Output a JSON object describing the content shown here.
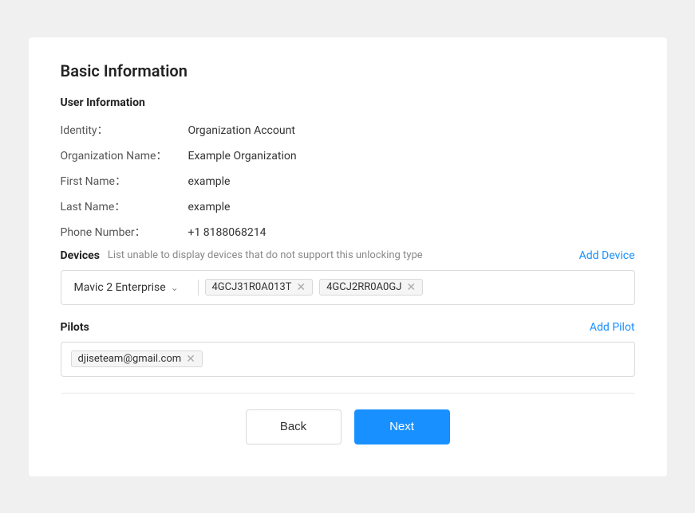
{
  "page": {
    "title": "Basic Information",
    "user_information_label": "User Information",
    "fields": {
      "identity_label": "Identity：",
      "identity_value": "Organization Account",
      "org_name_label": "Organization Name：",
      "org_name_value": "Example Organization",
      "first_name_label": "First Name：",
      "first_name_value": "example",
      "last_name_label": "Last Name：",
      "last_name_value": "example",
      "phone_label": "Phone Number：",
      "phone_value": "+1 8188068214"
    },
    "devices": {
      "label": "Devices",
      "hint": "List unable to display devices that do not support this unlocking type",
      "add_label": "Add Device",
      "select_value": "Mavic 2 Enterprise",
      "tags": [
        {
          "id": "tag-device-1",
          "value": "4GCJ31R0A013T"
        },
        {
          "id": "tag-device-2",
          "value": "4GCJ2RR0A0GJ"
        }
      ]
    },
    "pilots": {
      "label": "Pilots",
      "add_label": "Add Pilot",
      "tags": [
        {
          "id": "tag-pilot-1",
          "value": "djiseteam@gmail.com"
        }
      ]
    },
    "buttons": {
      "back_label": "Back",
      "next_label": "Next"
    }
  }
}
